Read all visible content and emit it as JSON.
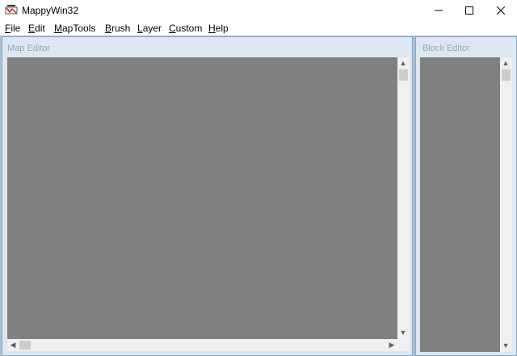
{
  "window": {
    "title": "MappyWin32"
  },
  "menu": [
    {
      "underline": "F",
      "rest": "ile"
    },
    {
      "underline": "E",
      "rest": "dit"
    },
    {
      "underline": "M",
      "rest": "apTools"
    },
    {
      "underline": "B",
      "rest": "rush"
    },
    {
      "underline": "L",
      "rest": "ayer"
    },
    {
      "underline": "C",
      "rest": "ustom"
    },
    {
      "underline": "H",
      "rest": "elp"
    }
  ],
  "map_editor": {
    "title": "Map Editor"
  },
  "block_editor": {
    "title": "Block Editor"
  },
  "colors": {
    "workspace": "#abc1d6",
    "panel": "#dce7f2",
    "canvas": "#808080"
  },
  "icons": {
    "minimize": "minimize-icon",
    "maximize": "maximize-icon",
    "close": "close-icon"
  }
}
